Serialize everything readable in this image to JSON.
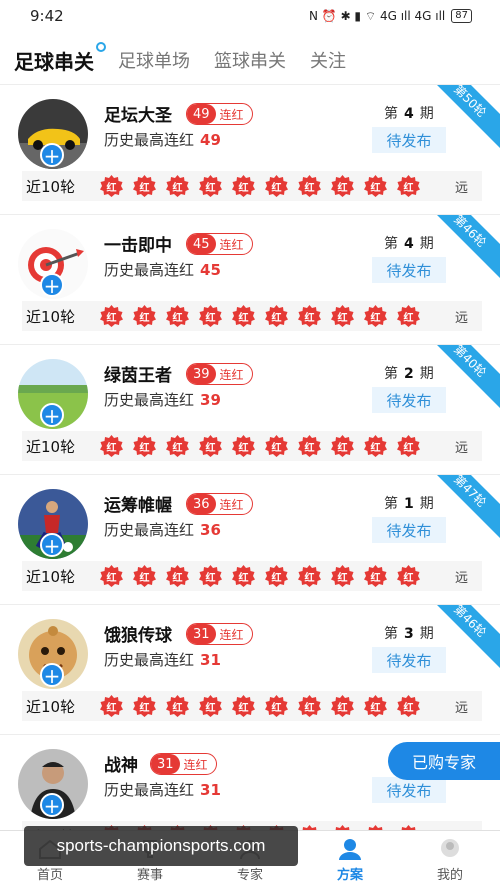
{
  "status_bar": {
    "time": "9:42",
    "network": "N ⏰ ✱ ▮ ⌔ 4G ıll 4G ıll",
    "battery": "87"
  },
  "tabs": [
    {
      "label": "足球串关"
    },
    {
      "label": "足球单场"
    },
    {
      "label": "篮球串关"
    },
    {
      "label": "关注"
    }
  ],
  "recent_label": "近10轮",
  "result_char": "红",
  "more_label": "远",
  "period_prefix": "第",
  "period_suffix": "期",
  "streak_suffix": "连红",
  "max_streak_label": "历史最高连红",
  "pending_label": "待发布",
  "experts": [
    {
      "name": "足坛大圣",
      "streak": "49",
      "max_streak": "49",
      "period": "4",
      "round": "第50轮",
      "avatar": "car"
    },
    {
      "name": "一击即中",
      "streak": "45",
      "max_streak": "45",
      "period": "4",
      "round": "第46轮",
      "avatar": "dart"
    },
    {
      "name": "绿茵王者",
      "streak": "39",
      "max_streak": "39",
      "period": "2",
      "round": "第40轮",
      "avatar": "field"
    },
    {
      "name": "运筹帷幄",
      "streak": "36",
      "max_streak": "36",
      "period": "1",
      "round": "第47轮",
      "avatar": "player"
    },
    {
      "name": "饿狼传球",
      "streak": "31",
      "max_streak": "31",
      "period": "3",
      "round": "第46轮",
      "avatar": "monk"
    },
    {
      "name": "战神",
      "streak": "31",
      "max_streak": "31",
      "period": "",
      "round": "",
      "avatar": "man"
    }
  ],
  "purchased_button": "已购专家",
  "bottom_nav": [
    {
      "label": "首页",
      "icon": "home-icon"
    },
    {
      "label": "赛事",
      "icon": "trophy-icon"
    },
    {
      "label": "专家",
      "icon": "expert-icon"
    },
    {
      "label": "方案",
      "icon": "user-icon"
    },
    {
      "label": "我的",
      "icon": "profile-icon"
    }
  ],
  "watermark": "sports-championsports.com",
  "colors": {
    "accent_blue": "#1e88e5",
    "ribbon_blue": "#2aa6e8",
    "red": "#e53935"
  }
}
